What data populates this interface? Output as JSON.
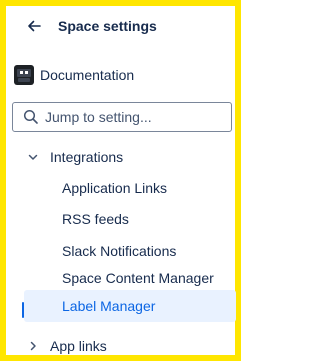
{
  "header": {
    "title": "Space settings"
  },
  "space": {
    "name": "Documentation"
  },
  "search": {
    "placeholder": "Jump to setting..."
  },
  "nav": {
    "integrations": {
      "label": "Integrations",
      "expanded": true,
      "children": [
        {
          "label": "Application Links"
        },
        {
          "label": "RSS feeds"
        },
        {
          "label": "Slack Notifications"
        },
        {
          "label": "Space Content Manager"
        },
        {
          "label": "Label Manager",
          "selected": true
        }
      ]
    },
    "app_links": {
      "label": "App links",
      "expanded": false
    }
  },
  "colors": {
    "frame": "#ffe600",
    "selected_bg": "#e9f2ff",
    "selected_text": "#0c66e4",
    "text": "#172b4d"
  },
  "icons": {
    "back": "arrow-left-icon",
    "search": "search-icon",
    "expanded": "chevron-down-icon",
    "collapsed": "chevron-right-icon"
  }
}
